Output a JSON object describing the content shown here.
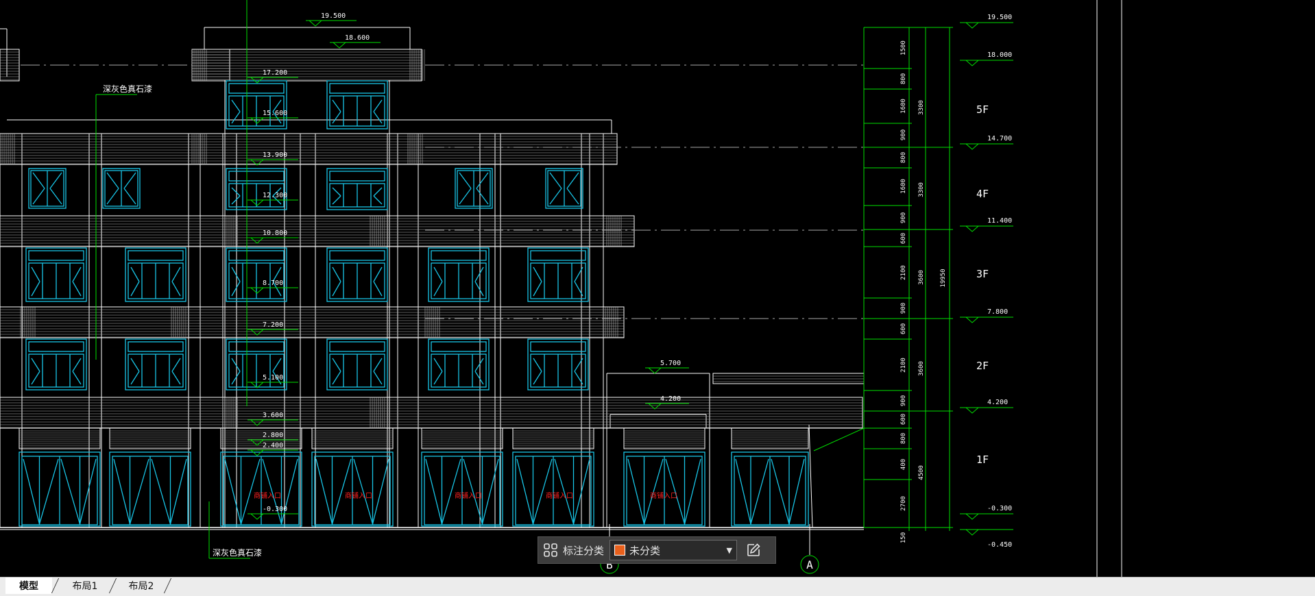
{
  "drawing": {
    "labels": {
      "material_top": "深灰色真石漆",
      "material_bottom": "深灰色真石漆",
      "shop_door": "商铺入口",
      "axis_b": "B",
      "axis_a": "A"
    },
    "elevations_left": [
      "19.500",
      "18.600",
      "17.200",
      "15.600",
      "13.900",
      "12.300",
      "10.800",
      "8.700",
      "7.200",
      "5.100",
      "3.600",
      "2.800",
      "2.400",
      "-0.300",
      "5.700",
      "4.200"
    ],
    "elevations_right": [
      "19.500",
      "18.000",
      "14.700",
      "11.400",
      "7.800",
      "4.200",
      "-0.300",
      "-0.450"
    ],
    "floors": [
      "5F",
      "4F",
      "3F",
      "2F",
      "1F"
    ],
    "dims_inner": [
      "1500",
      "800",
      "1600",
      "900",
      "800",
      "1600",
      "900",
      "600",
      "2100",
      "900",
      "600",
      "2100",
      "900",
      "600",
      "800",
      "400",
      "2700",
      "150"
    ],
    "dims_mid": [
      "3300",
      "3300",
      "3600",
      "3600",
      "4500"
    ],
    "dims_total": "19950"
  },
  "toolbar": {
    "label": "标注分类",
    "selected": "未分类",
    "swatch_color": "#e8601c"
  },
  "tabs": [
    "模型",
    "布局1",
    "布局2"
  ],
  "colors": {
    "cad_white": "#ffffff",
    "cad_green": "#00ff00",
    "cad_cyan": "#18c6e8",
    "cad_red": "#ff2020"
  }
}
